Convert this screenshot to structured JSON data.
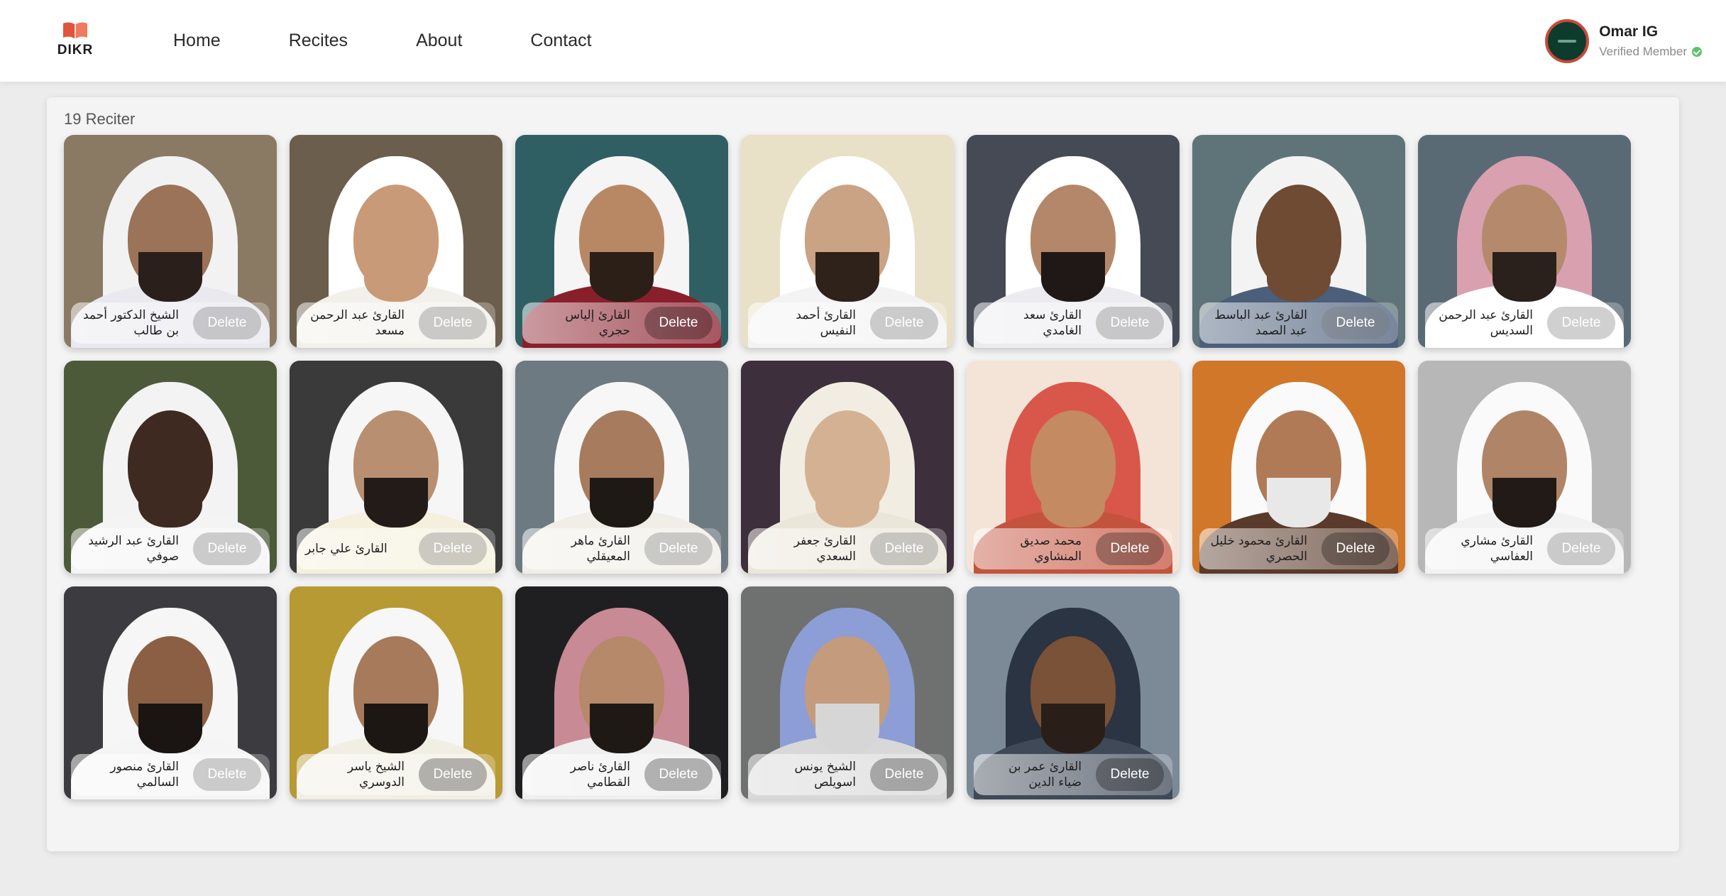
{
  "app": {
    "logo_text": "DIKR"
  },
  "nav": {
    "items": [
      "Home",
      "Recites",
      "About",
      "Contact"
    ]
  },
  "user": {
    "name": "Omar IG",
    "status": "Verified Member"
  },
  "main": {
    "count_label": "19 Reciter",
    "delete_label": "Delete",
    "reciters": [
      {
        "name": "الشيخ الدكتور أحمد بن طالب",
        "bg": "#8a7a64",
        "cloth": "#f2f2f2",
        "skin": "#9b7358",
        "beard": "#2a1f1a",
        "body": "#e9e9ef",
        "tone": "light"
      },
      {
        "name": "القارئ عبد الرحمن مسعد",
        "bg": "#6b5e4c",
        "cloth": "#ffffff",
        "skin": "#c99a78",
        "beard": "#c99a78",
        "body": "#f2f0ea",
        "tone": "light"
      },
      {
        "name": "القارئ إلياس حجري",
        "bg": "#2f5f63",
        "cloth": "#f5f5f5",
        "skin": "#b88865",
        "beard": "#2b1f18",
        "body": "#8a1f2c",
        "tone": "dark"
      },
      {
        "name": "القارئ أحمد النفيس",
        "bg": "#e8e1c8",
        "cloth": "#ffffff",
        "skin": "#c9a384",
        "beard": "#2e221b",
        "body": "#f3f3f3",
        "tone": "light"
      },
      {
        "name": "القارئ سعد الغامدي",
        "bg": "#454a55",
        "cloth": "#ffffff",
        "skin": "#b4876a",
        "beard": "#1f1816",
        "body": "#ececf0",
        "tone": "light"
      },
      {
        "name": "القارئ عبد الباسط عبد الصمد",
        "bg": "#5f7478",
        "cloth": "#f3f3f3",
        "skin": "#6f4b34",
        "beard": "#6f4b34",
        "body": "#4b5e7a",
        "tone": "light"
      },
      {
        "name": "القارئ عبد الرحمن السديس",
        "bg": "#5a6a74",
        "cloth": "#d9a0b0",
        "skin": "#b58a6c",
        "beard": "#2a201c",
        "body": "#ffffff",
        "tone": "light"
      },
      {
        "name": "القارئ عبد الرشيد صوفي",
        "bg": "#4c5a3a",
        "cloth": "#f3f3f3",
        "skin": "#3e2a20",
        "beard": "#3e2a20",
        "body": "#f4f4f4",
        "tone": "light"
      },
      {
        "name": "القارئ علي جابر",
        "bg": "#3a3a3a",
        "cloth": "#f6f6f6",
        "skin": "#b88f70",
        "beard": "#231b17",
        "body": "#f5f0dd",
        "tone": "light"
      },
      {
        "name": "القارئ ماهر المعيقلي",
        "bg": "#6d7a82",
        "cloth": "#f7f7f7",
        "skin": "#a77b5e",
        "beard": "#1f1915",
        "body": "#f0eee6",
        "tone": "light"
      },
      {
        "name": "القارئ جعفر السعدي",
        "bg": "#3d2f3b",
        "cloth": "#f1ede3",
        "skin": "#d5b194",
        "beard": "#d5b194",
        "body": "#ebe6da",
        "tone": "light"
      },
      {
        "name": "محمد صديق المنشاوي",
        "bg": "#f4e4d8",
        "cloth": "#d8574a",
        "skin": "#c48a62",
        "beard": "#c48a62",
        "body": "#c4533e",
        "tone": "dark"
      },
      {
        "name": "القارئ محمود خليل الحصري",
        "bg": "#d0772a",
        "cloth": "#fafafa",
        "skin": "#b07a57",
        "beard": "#e8e8e8",
        "body": "#5a3a2a",
        "tone": "dark"
      },
      {
        "name": "القارئ مشاري العفاسي",
        "bg": "#b7b7b7",
        "cloth": "#fafafa",
        "skin": "#b08466",
        "beard": "#221a16",
        "body": "#f2f2f2",
        "tone": "light"
      },
      {
        "name": "القارئ منصور السالمي",
        "bg": "#3c3c40",
        "cloth": "#f6f6f6",
        "skin": "#8a5f44",
        "beard": "#1a1412",
        "body": "#f5f5f5",
        "tone": "light"
      },
      {
        "name": "الشيخ ياسر الدوسري",
        "bg": "#b89a35",
        "cloth": "#f7f7f7",
        "skin": "#a67a5a",
        "beard": "#1d1713",
        "body": "#f1efe4",
        "tone": "dark"
      },
      {
        "name": "القارئ ناصر القطامي",
        "bg": "#1f1f22",
        "cloth": "#c88a95",
        "skin": "#b58969",
        "beard": "#1f1915",
        "body": "#efefef",
        "tone": "dark"
      },
      {
        "name": "الشيخ يونس اسويلص",
        "bg": "#6f7170",
        "cloth": "#8d9ed6",
        "skin": "#c49b7c",
        "beard": "#d6d6d6",
        "body": "#d8d8d8",
        "tone": "dark"
      },
      {
        "name": "القارئ عمر بن ضياء الدين",
        "bg": "#7c8a98",
        "cloth": "#2a3442",
        "skin": "#7a5238",
        "beard": "#2a1e18",
        "body": "#3f4957",
        "tone": "dark"
      }
    ]
  }
}
